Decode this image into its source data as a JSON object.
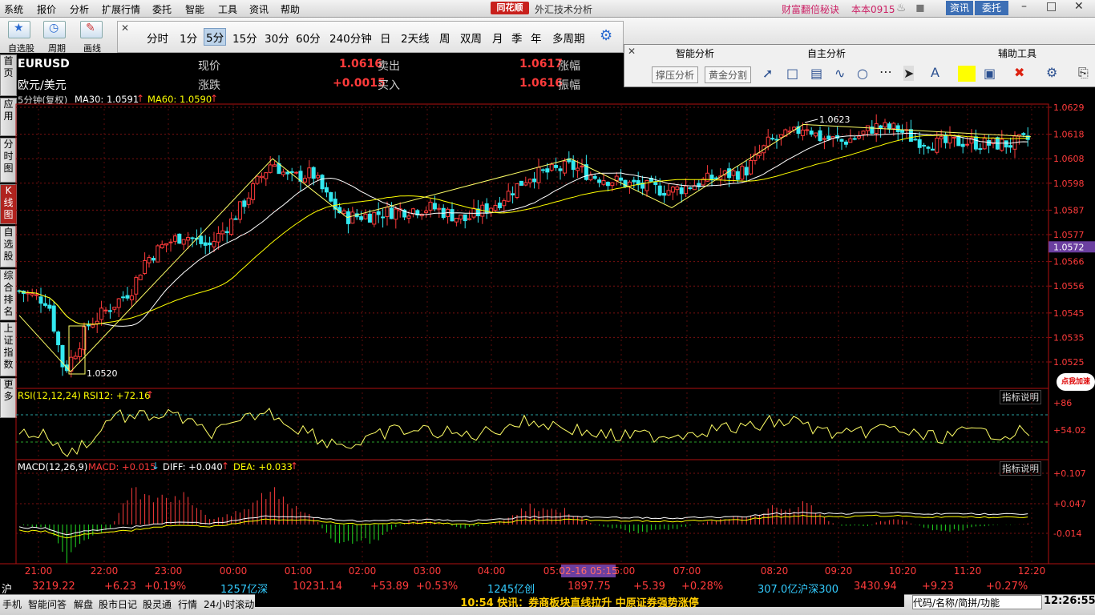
{
  "menu": [
    "系统",
    "报价",
    "分析",
    "扩展行情",
    "委托",
    "智能",
    "工具",
    "资讯",
    "帮助"
  ],
  "brand": "同花顺",
  "app_title": "外汇技术分析",
  "header_right": {
    "promo": "财富翻倍秘诀",
    "version": "本本0915",
    "news_btn": "资讯",
    "trade_btn": "委托"
  },
  "toolbar": {
    "left_buttons": [
      "自选股",
      "周期",
      "画线"
    ],
    "periods": [
      "分时",
      "1分",
      "5分",
      "15分",
      "30分",
      "60分",
      "240分钟",
      "日",
      "2天线",
      "周",
      "双周",
      "月",
      "季",
      "年",
      "多周期"
    ],
    "selected_period": "5分"
  },
  "panels": {
    "smart": {
      "title": "智能分析",
      "buttons": [
        "撑压分析",
        "黄金分割"
      ]
    },
    "self": {
      "title": "自主分析"
    },
    "assist": {
      "title": "辅助工具"
    }
  },
  "left_tabs": [
    "首页",
    "应用",
    "分时图",
    "K线图",
    "自选股",
    "综合排名",
    "上证指数",
    "更多"
  ],
  "active_tab": "K线图",
  "instrument": {
    "code": "EURUSD",
    "name": "欧元/美元",
    "now_label": "现价",
    "now_value": "1.0616",
    "sell_label": "卖出",
    "chg_label": "涨跌",
    "chg_value": "+0.0015",
    "buy_label": "买入",
    "sell_value": "1.0617",
    "rise_label": "涨幅",
    "buy_value": "1.0616",
    "amp_label": "振幅"
  },
  "ma_line": {
    "period": "5分钟(复权)",
    "ma30": "MA30: 1.0591",
    "ma60": "MA60: 1.0590"
  },
  "rsi_label": {
    "name": "RSI(12,12,24)",
    "value": "RSI12: +72.16",
    "explain": "指标说明"
  },
  "macd_label": {
    "name": "MACD(12,26,9)",
    "macd": "MACD: +0.015",
    "diff": "DIFF: +0.040",
    "dea": "DEA: +0.033",
    "explain": "指标说明"
  },
  "chart_data": {
    "type": "candlestick",
    "price_ticks": [
      "1.0629",
      "1.0618",
      "1.0608",
      "1.0598",
      "1.0587",
      "1.0577",
      "1.0566",
      "1.0556",
      "1.0545",
      "1.0535",
      "1.0525"
    ],
    "current_price": "1.0572",
    "high_mark": "1.0623",
    "low_mark": "1.0520",
    "rsi_ticks": [
      "+86",
      "+54.02"
    ],
    "macd_ticks": [
      "+0.107",
      "+0.047",
      "-0.014"
    ],
    "time_ticks": [
      "21:00",
      "22:00",
      "23:00",
      "00:00",
      "01:00",
      "02:00",
      "03:00",
      "04:00",
      "05:00",
      "06:00",
      "07:00",
      "08:20",
      "09:20",
      "10:20",
      "11:20",
      "12:20"
    ],
    "cursor_time": "02-16 05:15"
  },
  "index_bar": [
    {
      "t": "沪",
      "c": "#fff"
    },
    {
      "t": "3219.22",
      "c": "#ff3b3b"
    },
    {
      "t": "+6.23",
      "c": "#ff3b3b"
    },
    {
      "t": "+0.19%",
      "c": "#ff3b3b"
    },
    {
      "t": "1257亿深",
      "c": "#33ccff"
    },
    {
      "t": "10231.14",
      "c": "#ff3b3b"
    },
    {
      "t": "+53.89",
      "c": "#ff3b3b"
    },
    {
      "t": "+0.53%",
      "c": "#ff3b3b"
    },
    {
      "t": "1245亿创",
      "c": "#33ccff"
    },
    {
      "t": "1897.75",
      "c": "#ff3b3b"
    },
    {
      "t": "+5.39",
      "c": "#ff3b3b"
    },
    {
      "t": "+0.28%",
      "c": "#ff3b3b"
    },
    {
      "t": "307.0亿沪深300",
      "c": "#33ccff"
    },
    {
      "t": "3430.94",
      "c": "#ff3b3b"
    },
    {
      "t": "+9.23",
      "c": "#ff3b3b"
    },
    {
      "t": "+0.27%",
      "c": "#ff3b3b"
    }
  ],
  "status_bar": {
    "items": [
      "手机",
      "智能问答",
      "解盘",
      "股市日记",
      "股灵通",
      "行情",
      "24小时滚动"
    ],
    "news": "10:54 快讯：券商板块直线拉升 中原证券强势涨停",
    "code_placeholder": "代码/名称/简拼/功能",
    "clock": "12:26:55",
    "ad": "点我加速"
  }
}
